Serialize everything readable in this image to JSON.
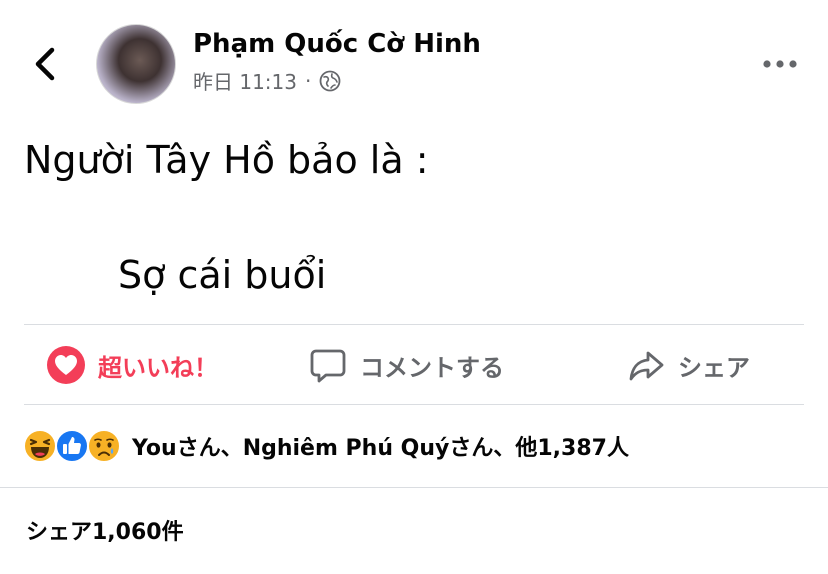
{
  "header": {
    "back_icon": "chevron-left-icon",
    "author_name": "Phạm Quốc Cờ Hinh",
    "timestamp": "昨日 11:13",
    "separator": "·",
    "privacy_icon": "globe-icon",
    "more_icon": "more-horizontal-icon"
  },
  "post": {
    "line1": "Người Tây Hồ bảo là :",
    "line2": "Sợ cái buổi"
  },
  "actions": {
    "like_label": "超いいね！",
    "comment_label": "コメントする",
    "share_label": "シェア"
  },
  "reactions": {
    "icons": [
      "haha-icon",
      "like-icon",
      "sad-icon"
    ],
    "summary": "Youさん、Nghiêm Phú Quýさん、他1,387人"
  },
  "shares": {
    "text": "シェア1,060件"
  },
  "colors": {
    "love_red": "#f33e58",
    "like_blue": "#1877f2",
    "reaction_yellow": "#f7b125",
    "secondary_text": "#65676b",
    "divider": "#dadde1"
  }
}
